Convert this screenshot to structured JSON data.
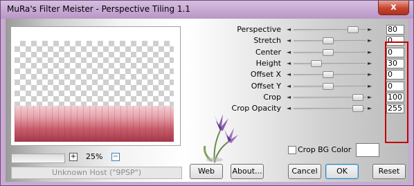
{
  "window": {
    "title": "MuRa's Filter Meister - Perspective Tiling 1.1",
    "close_label": "x"
  },
  "preview": {
    "zoom_minus": "−",
    "zoom_plus": "+",
    "zoom_value": "25%",
    "status": "Unknown Host (\"9PSP\")"
  },
  "params": [
    {
      "label": "Perspective",
      "value": "80"
    },
    {
      "label": "Stretch",
      "value": "0"
    },
    {
      "label": "Center",
      "value": "0"
    },
    {
      "label": "Height",
      "value": "30"
    },
    {
      "label": "Offset X",
      "value": "0"
    },
    {
      "label": "Offset Y",
      "value": "0"
    },
    {
      "label": "Crop",
      "value": "100"
    },
    {
      "label": "Crop Opacity",
      "value": "255"
    }
  ],
  "slider_arrows": {
    "left": "◄",
    "right": "►"
  },
  "crop_bg": {
    "label": "Crop BG Color",
    "checked": false,
    "color": "#ffffff"
  },
  "buttons": {
    "web": "Web",
    "about": "About...",
    "cancel": "Cancel",
    "ok": "OK",
    "reset": "Reset"
  },
  "colors": {
    "title_bar": "#c8aad3",
    "highlight_border": "#c00000",
    "floor_pink": "#c75c6b"
  }
}
